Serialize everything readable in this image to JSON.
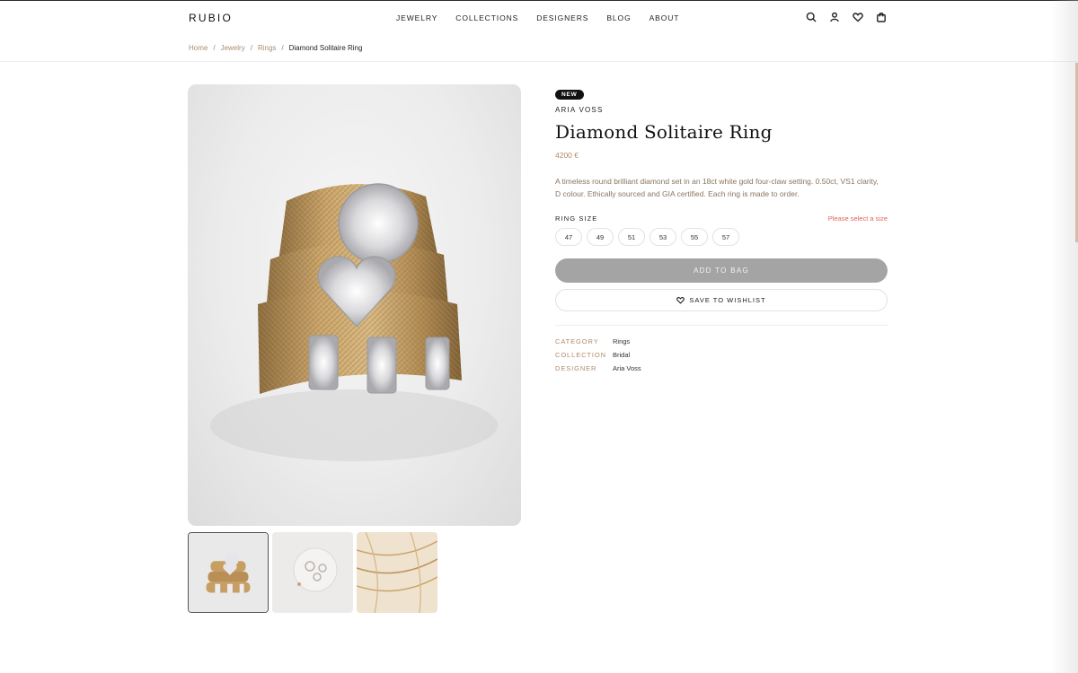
{
  "brand": {
    "logo": "RUBIO"
  },
  "nav": {
    "items": [
      {
        "label": "JEWELRY"
      },
      {
        "label": "COLLECTIONS"
      },
      {
        "label": "DESIGNERS"
      },
      {
        "label": "BLOG"
      },
      {
        "label": "ABOUT"
      }
    ],
    "icons": [
      "search-icon",
      "account-icon",
      "heart-icon",
      "bag-icon"
    ]
  },
  "breadcrumb": {
    "items": [
      "Home",
      "Jewelry",
      "Rings"
    ],
    "separator": "/",
    "current": "Diamond Solitaire Ring"
  },
  "product": {
    "badge": "NEW",
    "designer": "ARIA VOSS",
    "title": "Diamond Solitaire Ring",
    "price": "4200 €",
    "description": "A timeless round brilliant diamond set in an 18ct white gold four-claw setting. 0.50ct, VS1 clarity, D colour. Ethically sourced and GIA certified. Each ring is made to order.",
    "size_label": "RING SIZE",
    "size_warning": "Please select a size",
    "sizes": [
      "47",
      "49",
      "51",
      "53",
      "55",
      "57"
    ],
    "add_to_bag": "ADD TO BAG",
    "wishlist": "SAVE TO WISHLIST",
    "meta": [
      {
        "key": "CATEGORY",
        "value": "Rings"
      },
      {
        "key": "COLLECTION",
        "value": "Bridal"
      },
      {
        "key": "DESIGNER",
        "value": "Aria Voss"
      }
    ]
  },
  "colors": {
    "accent": "#b08a6a",
    "warning": "#e0645a",
    "button_disabled": "#a4a4a4",
    "badge": "#111111"
  }
}
